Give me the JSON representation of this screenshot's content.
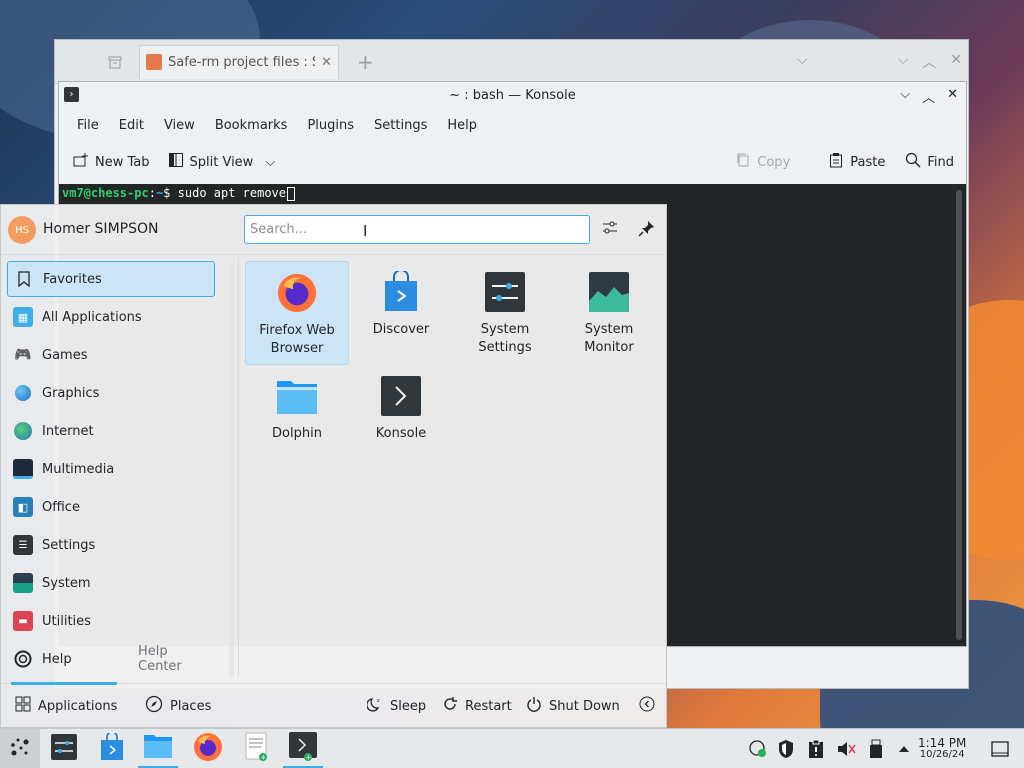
{
  "dolphin": {
    "tab_title": "Safe-rm project files : Safe"
  },
  "konsole": {
    "title": "~ : bash — Konsole",
    "menu": [
      "File",
      "Edit",
      "View",
      "Bookmarks",
      "Plugins",
      "Settings",
      "Help"
    ],
    "toolbar": {
      "new_tab": "New Tab",
      "split_view": "Split View",
      "copy": "Copy",
      "paste": "Paste",
      "find": "Find"
    },
    "terminal": {
      "user_host": "vm7@chess-pc",
      "path": "~",
      "prompt_char": "$",
      "command": "sudo apt remove"
    }
  },
  "launcher": {
    "user_initials": "HS",
    "user_name": "Homer SIMPSON",
    "search_placeholder": "Search...",
    "categories": [
      {
        "label": "Favorites",
        "icon": "bookmark-icon"
      },
      {
        "label": "All Applications",
        "icon": "grid-icon"
      },
      {
        "label": "Games",
        "icon": "gamepad-icon"
      },
      {
        "label": "Graphics",
        "icon": "graphics-icon"
      },
      {
        "label": "Internet",
        "icon": "globe-icon"
      },
      {
        "label": "Multimedia",
        "icon": "multimedia-icon"
      },
      {
        "label": "Office",
        "icon": "office-icon"
      },
      {
        "label": "Settings",
        "icon": "settings-icon"
      },
      {
        "label": "System",
        "icon": "system-icon"
      },
      {
        "label": "Utilities",
        "icon": "toolbox-icon"
      },
      {
        "label": "Help",
        "icon": "lifebuoy-icon"
      }
    ],
    "help_center": "Help Center",
    "apps": [
      {
        "label": "Firefox Web Browser",
        "icon": "firefox-icon"
      },
      {
        "label": "Discover",
        "icon": "discover-icon"
      },
      {
        "label": "System Settings",
        "icon": "system-settings-icon"
      },
      {
        "label": "System Monitor",
        "icon": "system-monitor-icon"
      },
      {
        "label": "Dolphin",
        "icon": "folder-icon"
      },
      {
        "label": "Konsole",
        "icon": "terminal-icon"
      }
    ],
    "footer": {
      "applications": "Applications",
      "places": "Places",
      "sleep": "Sleep",
      "restart": "Restart",
      "shutdown": "Shut Down"
    }
  },
  "taskbar": {
    "time": "1:14 PM",
    "date": "10/26/24"
  },
  "colors": {
    "accent": "#3daee9",
    "selection_bg": "#cce5f6",
    "terminal_bg": "#232627",
    "terminal_user": "#2ecc71"
  }
}
